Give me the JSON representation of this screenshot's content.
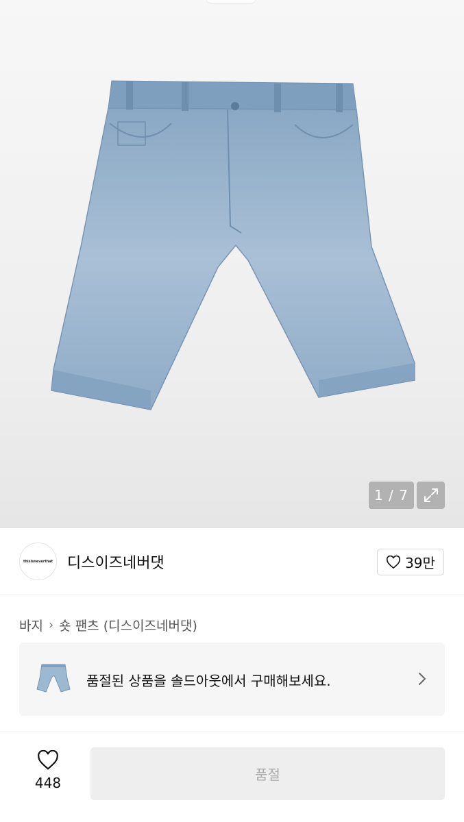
{
  "gallery": {
    "pager": "1 / 7",
    "image_alt": "denim-shorts"
  },
  "brand": {
    "logo_text": "thisisneverthat",
    "name": "디스이즈네버댓",
    "likes": "39만"
  },
  "breadcrumb": {
    "category": "바지",
    "subcategory": "숏 팬츠 (디스이즈네버댓)"
  },
  "banner": {
    "text": "품절된 상품을 솔드아웃에서 구매해보세요."
  },
  "bottom_bar": {
    "wish_count": "448",
    "buy_button": "품절"
  },
  "colors": {
    "denim": "#9db8d1",
    "button_bg": "#eeeeee",
    "button_text": "#aaaaaa"
  }
}
